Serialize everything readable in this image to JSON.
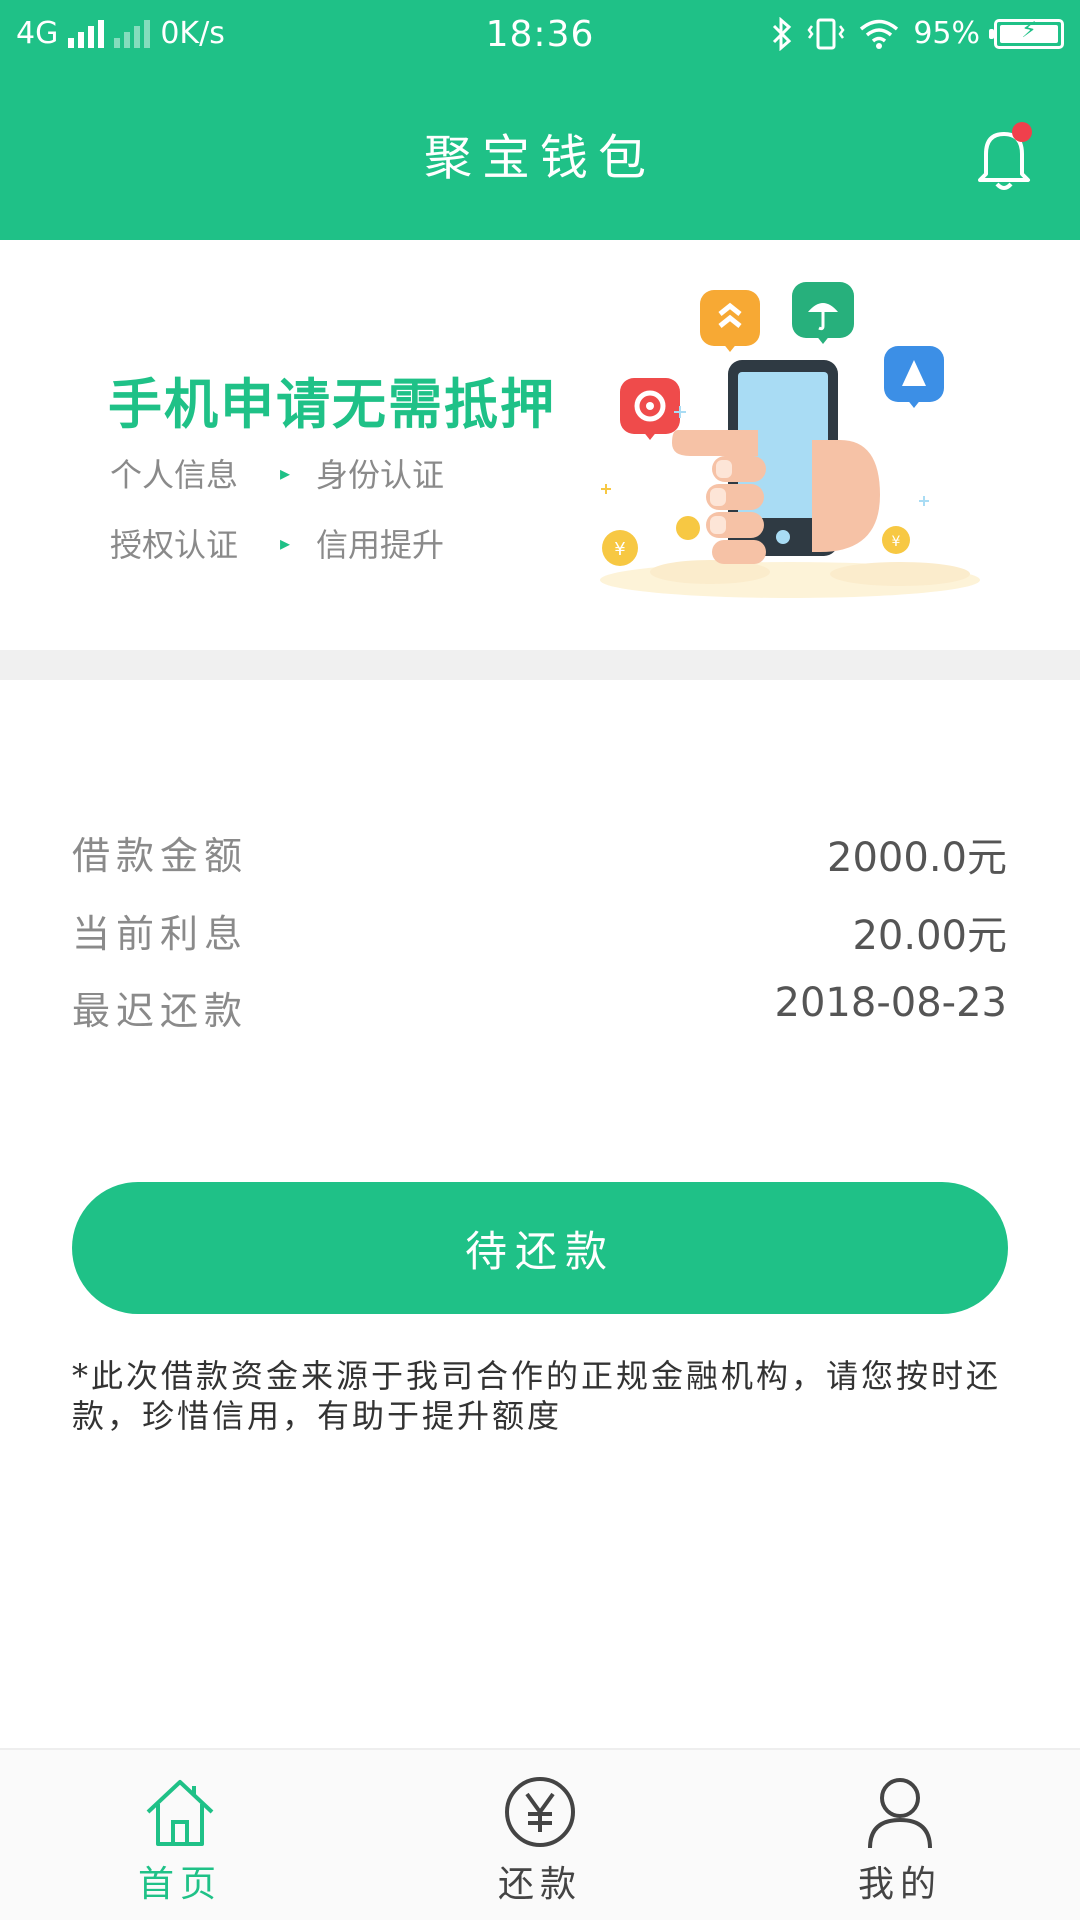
{
  "status_bar": {
    "network": "4G",
    "speed": "0K/s",
    "time": "18:36",
    "battery": "95%"
  },
  "header": {
    "title": "聚宝钱包",
    "icon": "bell-icon",
    "has_notification_dot": true
  },
  "banner": {
    "headline": "手机申请无需抵押",
    "steps": [
      "个人信息",
      "身份认证",
      "授权认证",
      "信用提升"
    ]
  },
  "loan": {
    "amount_label": "借款金额",
    "amount_value": "2000.0元",
    "interest_label": "当前利息",
    "interest_value": "20.00元",
    "due_label": "最迟还款",
    "due_value": "2018-08-23"
  },
  "action": {
    "button_label": "待还款"
  },
  "notice": "*此次借款资金来源于我司合作的正规金融机构，请您按时还款，珍惜信用，有助于提升额度",
  "tabs": [
    {
      "label": "首页",
      "icon": "home-icon",
      "active": true
    },
    {
      "label": "还款",
      "icon": "yen-circle-icon",
      "active": false
    },
    {
      "label": "我的",
      "icon": "user-icon",
      "active": false
    }
  ],
  "colors": {
    "primary": "#1fc187",
    "notification_dot": "#f0404c",
    "divider": "#f0f0f0"
  }
}
